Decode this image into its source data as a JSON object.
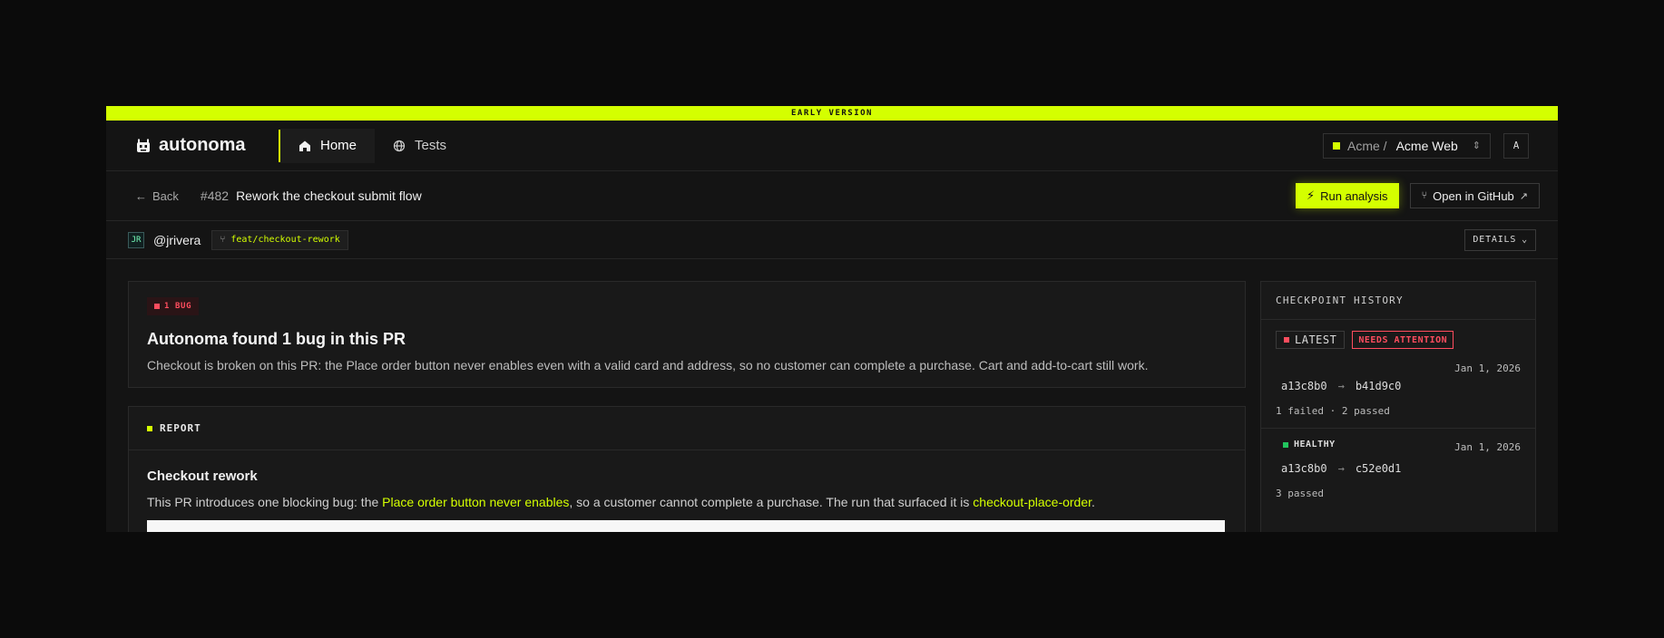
{
  "banner": "EARLY VERSION",
  "brand": {
    "name": "autonoma"
  },
  "nav": {
    "home": "Home",
    "tests": "Tests"
  },
  "org": {
    "prefix": "Acme /",
    "project": "Acme Web",
    "avatar_initial": "A"
  },
  "pr": {
    "back_label": "Back",
    "number": "#482",
    "title": "Rework the checkout submit flow"
  },
  "actions": {
    "run_analysis": "Run analysis",
    "open_github": "Open in GitHub"
  },
  "meta": {
    "avatar_text": "JR",
    "username": "@jrivera",
    "branch": "feat/checkout-rework",
    "details": "DETAILS"
  },
  "summary": {
    "badge": "1 BUG",
    "title": "Autonoma found 1 bug in this PR",
    "text": "Checkout is broken on this PR: the Place order button never enables even with a valid card and address, so no customer can complete a purchase. Cart and add-to-cart still work."
  },
  "report": {
    "header": "REPORT",
    "title": "Checkout rework",
    "text_before": "This PR introduces one blocking bug: the ",
    "link1": "Place order button never enables",
    "text_mid": ", so a customer cannot complete a purchase. The run that surfaced it is ",
    "link2": "checkout-place-order",
    "text_after": "."
  },
  "history": {
    "header": "CHECKPOINT HISTORY",
    "latest": {
      "tag": "LATEST",
      "attention": "NEEDS ATTENTION",
      "date": "Jan 1, 2026",
      "from": "a13c8b0",
      "to": "b41d9c0",
      "status": "1 failed · 2 passed"
    },
    "healthy": {
      "tag": "HEALTHY",
      "date": "Jan 1, 2026",
      "from": "a13c8b0",
      "to": "c52e0d1",
      "status": "3 passed"
    }
  },
  "colors": {
    "accent": "#d4ff00",
    "danger": "#ff4d5e",
    "healthy": "#22c55e",
    "background": "#141414"
  }
}
